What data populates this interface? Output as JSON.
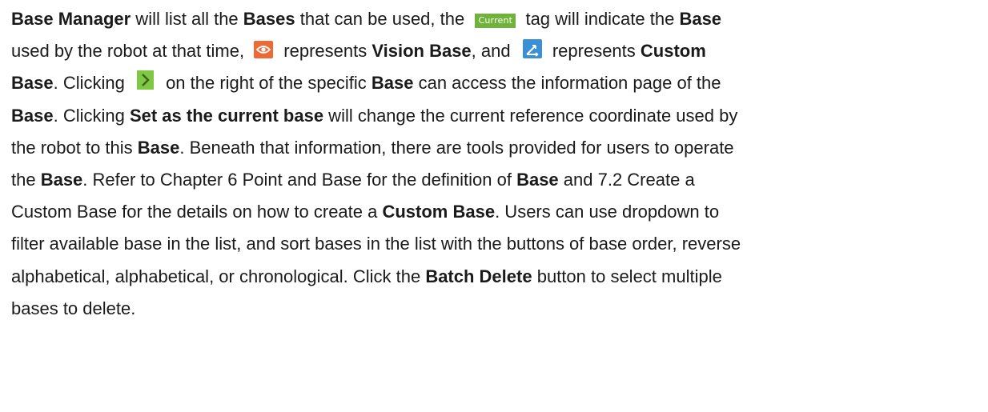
{
  "paragraph": {
    "l1": {
      "t1": "Base Manager",
      "t2": " will list all the ",
      "t3": "Bases",
      "t4": " that can be used, the ",
      "tag": "Current",
      "t5": " tag will indicate the ",
      "t6": "Base"
    },
    "l2": {
      "t1": "used by the robot at that time, ",
      "t2": " represents ",
      "t3": "Vision Base",
      "t4": ", and ",
      "t5": " represents ",
      "t6": "Custom"
    },
    "l3": {
      "t1": "Base",
      "t2": ". Clicking ",
      "t3": " on the right of the specific ",
      "t4": "Base",
      "t5": " can access the information page of the"
    },
    "l4": {
      "t1": "Base",
      "t2": ". Clicking ",
      "t3": "Set as the current base",
      "t4": " will change the current reference coordinate used by"
    },
    "l5": {
      "t1": "the robot to this ",
      "t2": "Base",
      "t3": ". Beneath that information, there are tools provided for users to operate"
    },
    "l6": {
      "t1": "the ",
      "t2": "Base",
      "t3": ". Refer to Chapter 6 Point and Base for the definition of ",
      "t4": "Base",
      "t5": " and 7.2 Create a"
    },
    "l7": {
      "t1": "Custom Base for the details on how to create a ",
      "t2": "Custom Base",
      "t3": ". Users can use dropdown to"
    },
    "l8": {
      "t1": "filter available base in the list, and sort bases in the list with the buttons of base order, reverse"
    },
    "l9": {
      "t1": "alphabetical, alphabetical, or chronological. Click the ",
      "t2": "Batch Delete",
      "t3": " button to select multiple"
    },
    "l10": {
      "t1": "bases to delete."
    }
  },
  "icons": {
    "current_tag": "current-tag",
    "vision_base": "eye-icon",
    "custom_base": "custom-base-icon",
    "access": "chevron-right-icon"
  },
  "colors": {
    "current_tag_bg": "#6fb339",
    "vision_icon_bg": "#ee6a34",
    "custom_icon_bg": "#3a8fd6",
    "chevron_icon_bg": "#7fc843"
  }
}
